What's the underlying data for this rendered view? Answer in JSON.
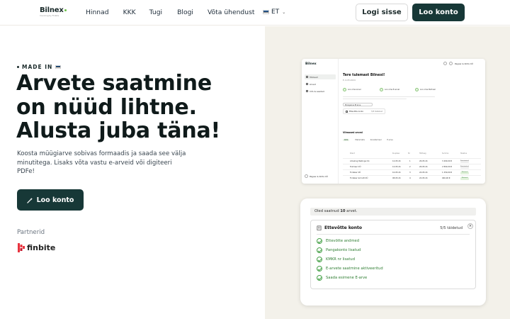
{
  "header": {
    "logo_text": "Bilnex",
    "logo_sub": "Invoicing by Finbite",
    "nav": [
      "Hinnad",
      "KKK",
      "Tugi",
      "Blogi",
      "Võta ühendust"
    ],
    "language": "ET",
    "login_label": "Logi sisse",
    "signup_label": "Loo konto"
  },
  "hero": {
    "made_in": "MADE IN",
    "headline": [
      "Arvete saatmine",
      "on nüüd lihtne.",
      "Alusta juba täna!"
    ],
    "subtitle": "Koosta müügiarve sobivas formaadis ja saada see välja minutitega. Lisaks võta vastu e-arveid või digiteeri PDFe!",
    "cta_label": "Loo konto",
    "partners_label": "Partnerid",
    "partner_name": "finbite"
  },
  "app_preview": {
    "logo": "Bilnex",
    "sidebar": [
      "Töölaud",
      "Arved",
      "Info & seaded"
    ],
    "user": "Pagaar & Kõrts OÜ",
    "top_user": "Pagaar & Kõrts OÜ",
    "title": "Tere tulemast Bilnexi!",
    "date": "E, 6.05.2024",
    "steps": [
      "Loo oma arvel",
      "Loo oma E-arvel",
      "Loo oma Partneri"
    ],
    "pill": "Müügiarve ▼ arve",
    "box": "Ettevõtte konto",
    "box_count": "5/5 täidetud",
    "section": "Viimased arved",
    "tabs": [
      "Kõik",
      "Maksmata",
      "Koostamisel",
      "E-arve"
    ],
    "header_cols": [
      "Klient",
      "Kuupäev",
      "Nr",
      "Tähtaeg",
      "Summa",
      "Staatus"
    ],
    "rows": [
      {
        "client": "Amazing Pastings Oü",
        "date": "12.05.24",
        "nr": "1",
        "due": "26.05.24",
        "sum": "3 400,00 €",
        "status": "Koostamisel"
      },
      {
        "client": "Toimiser OÜ",
        "date": "12.05.24",
        "nr": "2",
        "due": "26.05.24",
        "sum": "2 800,00 €",
        "status": "Koostamisel"
      },
      {
        "client": "Tinteker OÜ",
        "date": "10.05.24",
        "nr": "3",
        "due": "24.05.24",
        "sum": "1 250,00 €",
        "status": "Makstud"
      },
      {
        "client": "Tinteker Grmutt OÜ",
        "date": "08.05.24",
        "nr": "4",
        "due": "22.05.24",
        "sum": "940,00 €",
        "status": "Makstud"
      }
    ]
  },
  "onboarding": {
    "bar_prefix": "Oled saatnud",
    "bar_count": "10",
    "bar_suffix": "arvet.",
    "title": "Ettevõtte konto",
    "count": "5/5 täidetud",
    "close": "×",
    "items": [
      "Ettevõtte andmed",
      "Pangakonto lisatud",
      "KMKR nr lisatud",
      "E-arvete saatmine aktiveeritud",
      "Saada esimene E-arve"
    ]
  },
  "colors": {
    "brand_dark": "#173837",
    "right_bg": "#f3f1ea",
    "success": "#48a24a"
  }
}
